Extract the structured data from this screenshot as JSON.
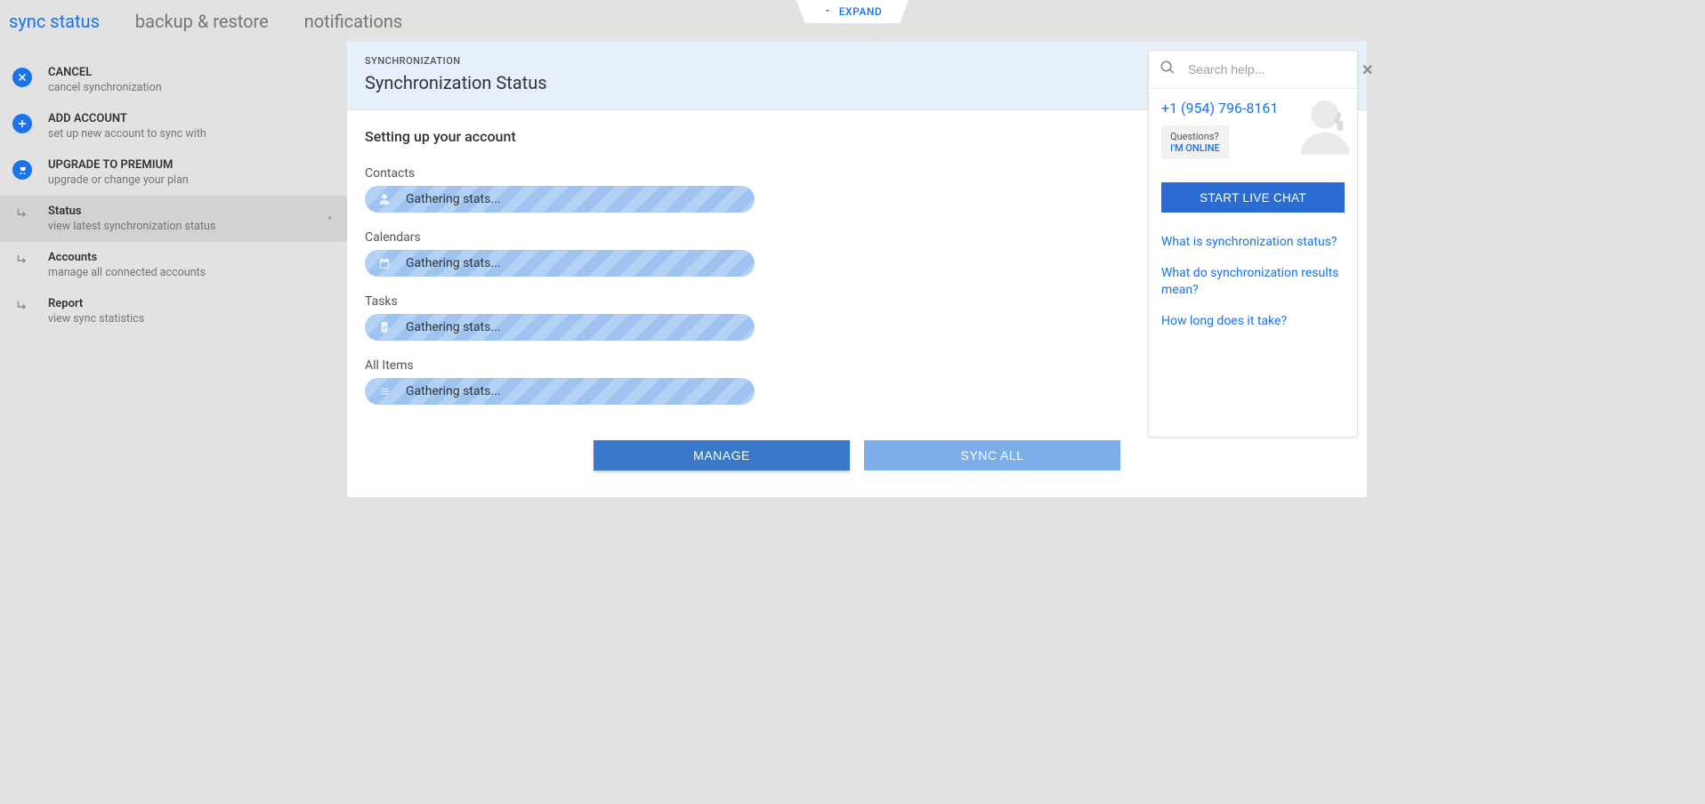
{
  "topbar": {
    "tabs": [
      {
        "label": "sync status",
        "active": true
      },
      {
        "label": "backup & restore",
        "active": false
      },
      {
        "label": "notifications",
        "active": false
      }
    ],
    "expand_label": "EXPAND"
  },
  "sidebar": {
    "actions": [
      {
        "title": "CANCEL",
        "subtitle": "cancel synchronization",
        "icon": "close-circle"
      },
      {
        "title": "ADD ACCOUNT",
        "subtitle": "set up new account to sync with",
        "icon": "plus-circle"
      },
      {
        "title": "UPGRADE TO PREMIUM",
        "subtitle": "upgrade or change your plan",
        "icon": "cart-circle"
      }
    ],
    "nav": [
      {
        "title": "Status",
        "subtitle": "view latest synchronization status",
        "active": true,
        "chevron": true
      },
      {
        "title": "Accounts",
        "subtitle": "manage all connected accounts",
        "active": false
      },
      {
        "title": "Report",
        "subtitle": "view sync statistics",
        "active": false
      }
    ]
  },
  "panel": {
    "eyebrow": "SYNCHRONIZATION",
    "title": "Synchronization Status",
    "setup_title": "Setting up your account",
    "groups": [
      {
        "label": "Contacts",
        "status": "Gathering stats...",
        "icon": "person"
      },
      {
        "label": "Calendars",
        "status": "Gathering stats...",
        "icon": "calendar"
      },
      {
        "label": "Tasks",
        "status": "Gathering stats...",
        "icon": "clipboard"
      },
      {
        "label": "All Items",
        "status": "Gathering stats...",
        "icon": "list"
      }
    ],
    "buttons": {
      "manage": "MANAGE",
      "sync_all": "SYNC ALL"
    }
  },
  "help": {
    "search_placeholder": "Search help...",
    "phone": "+1 (954) 796-8161",
    "bubble_question": "Questions?",
    "bubble_online": "I'M ONLINE",
    "chat_button": "START LIVE CHAT",
    "links": [
      "What is synchronization status?",
      "What do synchronization results mean?",
      "How long does it take?"
    ]
  }
}
